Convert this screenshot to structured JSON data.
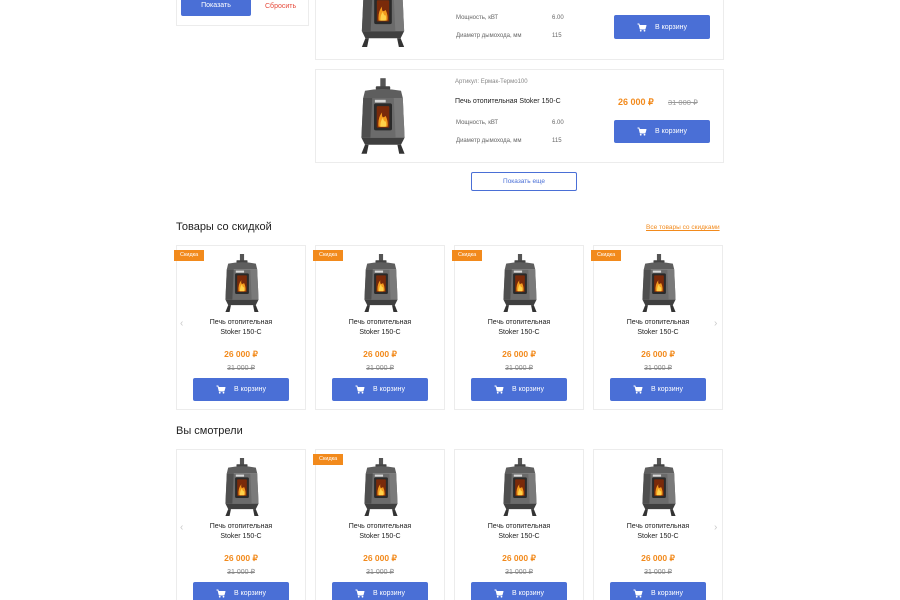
{
  "filter": {
    "show_label": "Показать",
    "reset_label": "Сбросить"
  },
  "list_rows": [
    {
      "sku": "",
      "name": "",
      "props": [
        {
          "label": "Мощность, кВТ",
          "value": "6.00"
        },
        {
          "label": "Диаметр дымохода, мм",
          "value": "115"
        }
      ],
      "price": "",
      "old_price": "",
      "cart_label": "В корзину"
    },
    {
      "sku": "Артикул: Ермак-Термо100",
      "name": "Печь отопительная Stoker 150-C",
      "props": [
        {
          "label": "Мощность, кВТ",
          "value": "6.00"
        },
        {
          "label": "Диаметр дымохода, мм",
          "value": "115"
        }
      ],
      "price": "26 000 ₽",
      "old_price": "31 000 ₽",
      "cart_label": "В корзину"
    }
  ],
  "show_more_label": "Показать еще",
  "discount_section": {
    "title": "Товары со скидкой",
    "link_label": "Все товары со скидками",
    "products": [
      {
        "badge": "Скидка",
        "name_line1": "Печь отопительная",
        "name_line2": "Stoker 150-C",
        "price": "26 000 ₽",
        "old_price": "31 000 ₽",
        "cart_label": "В корзину"
      },
      {
        "badge": "Скидка",
        "name_line1": "Печь отопительная",
        "name_line2": "Stoker 150-C",
        "price": "26 000 ₽",
        "old_price": "31 000 ₽",
        "cart_label": "В корзину"
      },
      {
        "badge": "Скидка",
        "name_line1": "Печь отопительная",
        "name_line2": "Stoker 150-C",
        "price": "26 000 ₽",
        "old_price": "31 000 ₽",
        "cart_label": "В корзину"
      },
      {
        "badge": "Скидка",
        "name_line1": "Печь отопительная",
        "name_line2": "Stoker 150-C",
        "price": "26 000 ₽",
        "old_price": "31 000 ₽",
        "cart_label": "В корзину"
      }
    ]
  },
  "viewed_section": {
    "title": "Вы смотрели",
    "products": [
      {
        "badge": "",
        "name_line1": "Печь отопительная",
        "name_line2": "Stoker 150-C",
        "price": "26 000 ₽",
        "old_price": "31 000 ₽",
        "cart_label": "В корзину"
      },
      {
        "badge": "Скидка",
        "name_line1": "Печь отопительная",
        "name_line2": "Stoker 150-C",
        "price": "26 000 ₽",
        "old_price": "31 000 ₽",
        "cart_label": "В корзину"
      },
      {
        "badge": "",
        "name_line1": "Печь отопительная",
        "name_line2": "Stoker 150-C",
        "price": "26 000 ₽",
        "old_price": "31 000 ₽",
        "cart_label": "В корзину"
      },
      {
        "badge": "",
        "name_line1": "Печь отопительная",
        "name_line2": "Stoker 150-C",
        "price": "26 000 ₽",
        "old_price": "31 000 ₽",
        "cart_label": "В корзину"
      }
    ]
  },
  "icons": {
    "cart": "cart-icon",
    "prev": "chevron-left-icon",
    "next": "chevron-right-icon",
    "product": "stove-image"
  },
  "colors": {
    "accent_blue": "#4a6fd6",
    "accent_orange": "#f28a1c",
    "reset_red": "#e64a3b",
    "border": "#ececec"
  }
}
